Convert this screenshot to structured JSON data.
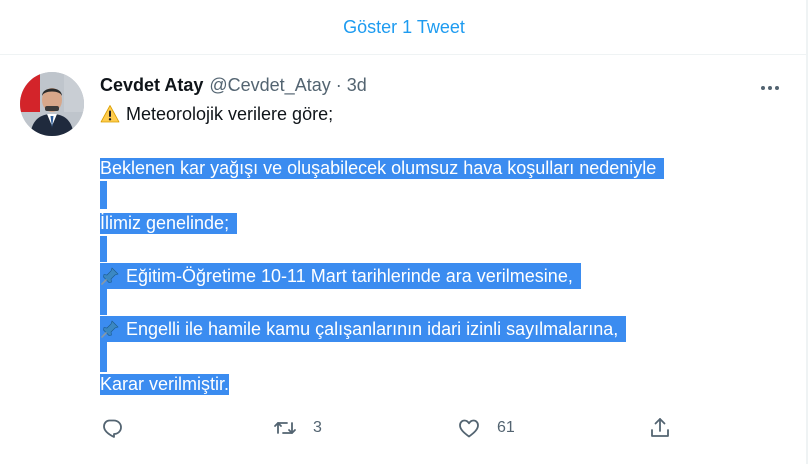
{
  "timeline": {
    "show_more_label": "Göster 1 Tweet"
  },
  "tweet": {
    "author_name": "Cevdet Atay",
    "handle": "@Cevdet_Atay",
    "separator": "·",
    "time": "3d",
    "line1": "Meteorolojik verilere göre;",
    "line2": "Beklenen kar yağışı ve  oluşabilecek olumsuz hava koşulları nedeniyle",
    "line3": "İlimiz genelinde;",
    "line4": "Eğitim-Öğretime 10-11 Mart tarihlerinde ara verilmesine,",
    "line5": "Engelli ile hamile kamu çalışanlarının idari izinli sayılmalarına,",
    "line6": "Karar verilmiştir."
  },
  "actions": {
    "reply_count": "",
    "retweet_count": "3",
    "like_count": "61"
  },
  "icons": [
    "warning-icon",
    "pushpin-icon",
    "reply-icon",
    "retweet-icon",
    "like-icon",
    "share-icon",
    "more-icon"
  ],
  "colors": {
    "accent": "#1d9bf0",
    "selection": "#3b8cf0",
    "muted": "#536471"
  }
}
